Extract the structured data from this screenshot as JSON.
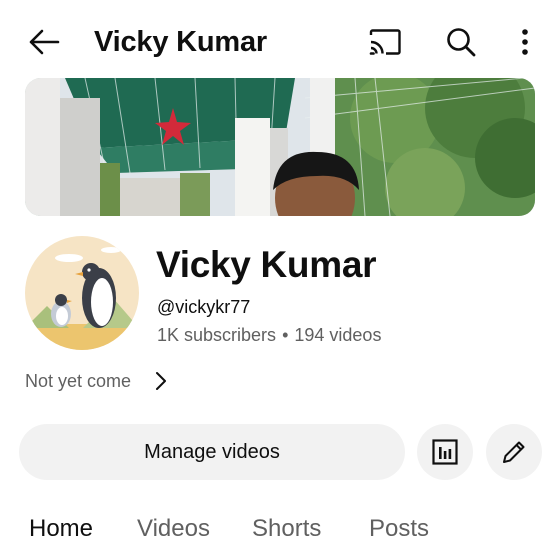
{
  "header": {
    "title": "Vicky Kumar",
    "icons": [
      "back-arrow-icon",
      "cast-icon",
      "search-icon",
      "more-vert-icon"
    ]
  },
  "banner": {
    "description_icon": "channel-banner-image"
  },
  "channel": {
    "name": "Vicky Kumar",
    "handle": "@vickykr77",
    "subscribers": "1K subscribers",
    "separator": "•",
    "videos": "194 videos",
    "about": "Not yet come"
  },
  "actions": {
    "manage_videos": "Manage videos",
    "icons": [
      "analytics-icon",
      "edit-pencil-icon"
    ]
  },
  "tabs": [
    {
      "label": "Home",
      "active": true
    },
    {
      "label": "Videos",
      "active": false
    },
    {
      "label": "Shorts",
      "active": false
    },
    {
      "label": "Posts",
      "active": false
    }
  ],
  "colors": {
    "text": "#0f0f0f",
    "secondary": "#606060",
    "button_bg": "#f2f2f2",
    "avatar_bg": "#f6e4c5"
  }
}
